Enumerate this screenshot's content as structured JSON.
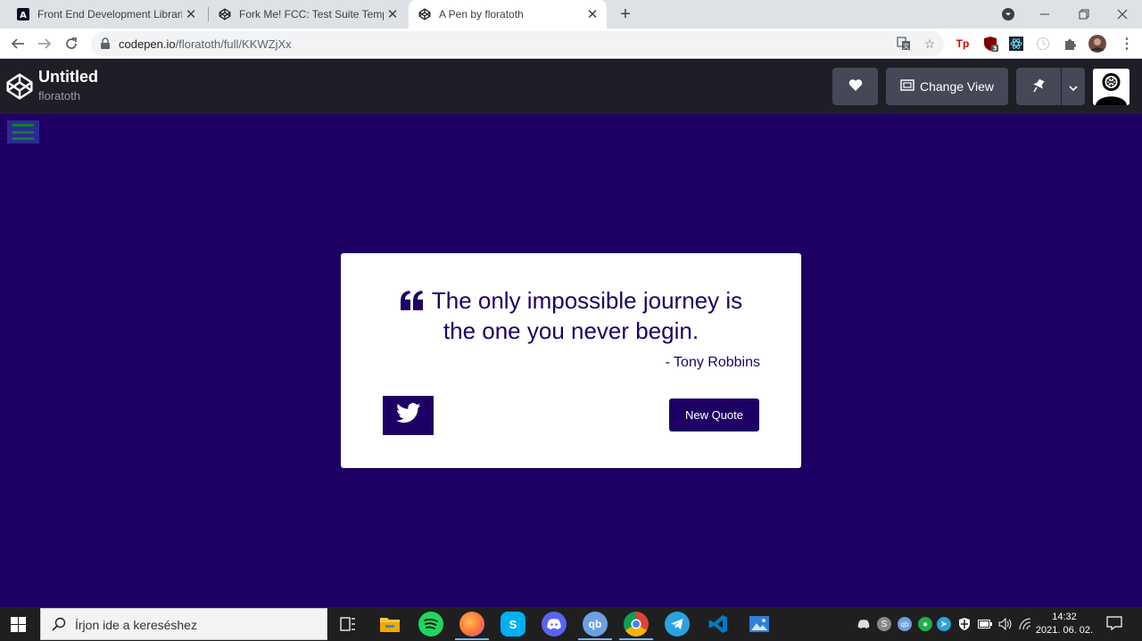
{
  "browser": {
    "tabs": [
      {
        "title": "Front End Development Libraries",
        "favicon": "freecodecamp-icon",
        "active": false
      },
      {
        "title": "Fork Me! FCC: Test Suite Template",
        "favicon": "codepen-icon",
        "active": false
      },
      {
        "title": "A Pen by floratoth",
        "favicon": "codepen-icon",
        "active": true
      }
    ],
    "url": {
      "domain": "codepen.io",
      "path": "/floratoth/full/KKWZjXx"
    },
    "extension_badge": "3"
  },
  "codepen": {
    "title": "Untitled",
    "username": "floratoth",
    "change_view_label": "Change View"
  },
  "quote": {
    "text": "The only impossible journey is the one you never begin.",
    "author": "- Tony Robbins",
    "new_quote_label": "New Quote"
  },
  "taskbar": {
    "search_placeholder": "Írjon ide a kereséshez",
    "time": "14:32",
    "date": "2021. 06. 02."
  },
  "colors": {
    "background": "#1e0064",
    "codepen_header": "#1e1f26",
    "hamburger_lines": "#117d2a"
  }
}
